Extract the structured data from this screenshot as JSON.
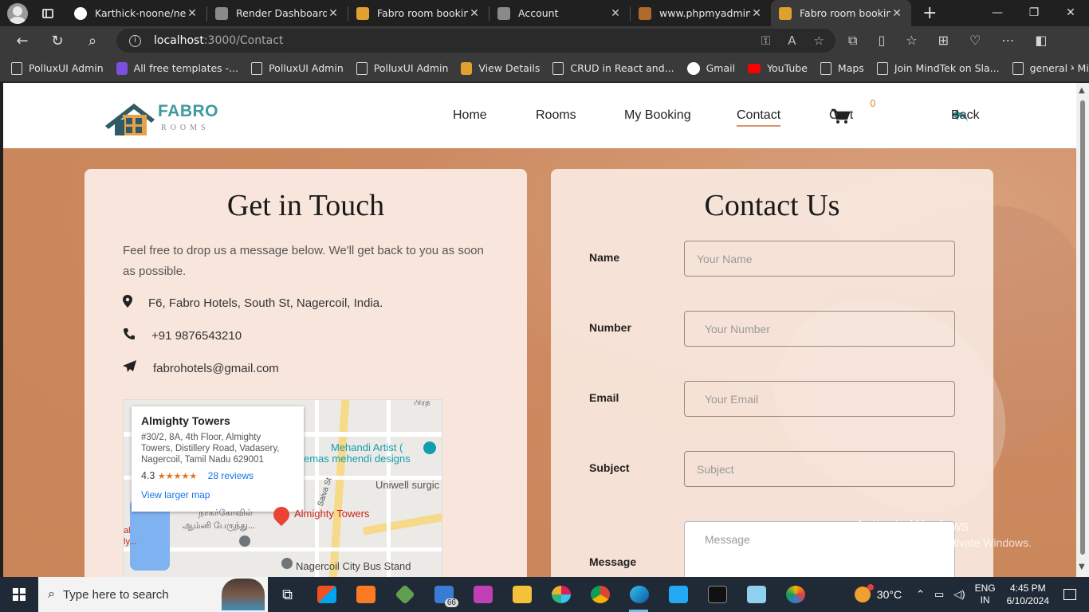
{
  "browser": {
    "tabs": [
      {
        "title": "Karthick-noone/new",
        "favicon_color": "#ffffff"
      },
      {
        "title": "Render Dashboard",
        "favicon_color": "#8a8a8a"
      },
      {
        "title": "Fabro room booking",
        "favicon_color": "#e0a030"
      },
      {
        "title": "Account",
        "favicon_color": "#8a8a8a"
      },
      {
        "title": "www.phpmyadmin.co",
        "favicon_color": "#b06a2a"
      },
      {
        "title": "Fabro room booking",
        "favicon_color": "#e0a030"
      }
    ],
    "address": {
      "host": "localhost",
      "rest": ":3000/Contact"
    },
    "bookmarks": [
      {
        "label": "PolluxUI Admin",
        "icon": "doc-icon"
      },
      {
        "label": "All free templates -...",
        "icon": "template-icon",
        "color": "#7b4fe0"
      },
      {
        "label": "PolluxUI Admin",
        "icon": "doc-icon"
      },
      {
        "label": "PolluxUI Admin",
        "icon": "doc-icon"
      },
      {
        "label": "View Details",
        "icon": "hotel-icon",
        "color": "#e0a030"
      },
      {
        "label": "CRUD in React and...",
        "icon": "doc-icon"
      },
      {
        "label": "Gmail",
        "icon": "google-icon",
        "color": "#ffffff"
      },
      {
        "label": "YouTube",
        "icon": "youtube-icon",
        "color": "#ff0000"
      },
      {
        "label": "Maps",
        "icon": "doc-icon"
      },
      {
        "label": "Join MindTek on Sla...",
        "icon": "doc-icon"
      },
      {
        "label": "general - MindTek -...",
        "icon": "doc-icon"
      }
    ]
  },
  "site": {
    "logo": {
      "name": "FABRO",
      "sub": "ROOMS"
    },
    "nav": {
      "home": "Home",
      "rooms": "Rooms",
      "my_booking": "My Booking",
      "contact": "Contact",
      "cart": "Cart",
      "cart_count": "0",
      "back": "Back"
    },
    "touch": {
      "title": "Get in Touch",
      "intro": "Feel free to drop us a message below. We'll get back to you as soon as possible.",
      "address": "F6, Fabro Hotels, South St, Nagercoil, India.",
      "phone": "+91 9876543210",
      "email": "fabrohotels@gmail.com"
    },
    "map": {
      "place": "Almighty Towers",
      "address": "#30/2, 8A, 4th Floor, Almighty Towers, Distillery Road, Vadasery, Nagercoil, Tamil Nadu 629001",
      "rating": "4.3",
      "stars": "★★★★★",
      "reviews": "28 reviews",
      "larger": "View larger map",
      "labels": {
        "pin": "Almighty Towers",
        "mehandi1": "Mehandi Artist (",
        "mehandi2": "emas mehendi designs",
        "uniwell": "Uniwell surgic",
        "saiva": "Saiva St",
        "tamil1": "நாகர்கோவில்",
        "tamil2": "ஆம்னி பேருந்து...",
        "tamil3": "பிரத",
        "bus": "Nagercoil City Bus Stand",
        "edge_al": "al",
        "edge_ly": "ly..."
      }
    },
    "contact": {
      "title": "Contact Us",
      "name_label": "Name",
      "name_placeholder": "Your Name",
      "number_label": "Number",
      "number_placeholder": "Your Number",
      "email_label": "Email",
      "email_placeholder": "Your Email",
      "subject_label": "Subject",
      "subject_placeholder": "Subject",
      "message_label": "Message",
      "message_placeholder": "Message"
    },
    "watermark": {
      "line1": "Activate Windows",
      "line2": "Go to Settings to activate Windows."
    }
  },
  "taskbar": {
    "search_placeholder": "Type here to search",
    "mail_badge": "66",
    "weather": "30°C",
    "lang1": "ENG",
    "lang2": "IN",
    "time": "4:45 PM",
    "date": "6/10/2024"
  }
}
